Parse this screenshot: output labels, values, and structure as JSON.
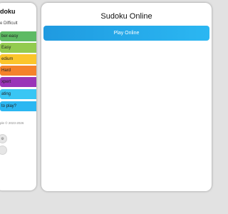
{
  "sidebar": {
    "title": "doku",
    "choose_label": "e Difficult",
    "levels": [
      {
        "label": "ber-easy",
        "color": "#5eba64"
      },
      {
        "label": "Easy",
        "color": "#93cb4f"
      },
      {
        "label": "edium",
        "color": "#fbc52b"
      },
      {
        "label": "Hard",
        "color": "#f5822b"
      },
      {
        "label": "xpert",
        "color": "#9a35b8"
      },
      {
        "label": "ating",
        "color": "#39c6f4"
      },
      {
        "label": "to play?",
        "color": "#2bb7f2"
      }
    ],
    "copyright": "ple © 2023-2026",
    "round_buttons": [
      {
        "icon": "settings-icon",
        "glyph": "⚙"
      },
      {
        "icon": "theme-toggle-icon",
        "glyph": ""
      }
    ]
  },
  "main": {
    "title": "Sudoku Online",
    "play_button": "Play Online",
    "play_gradient": [
      "#1f9ae0",
      "#2bb7f2"
    ]
  }
}
